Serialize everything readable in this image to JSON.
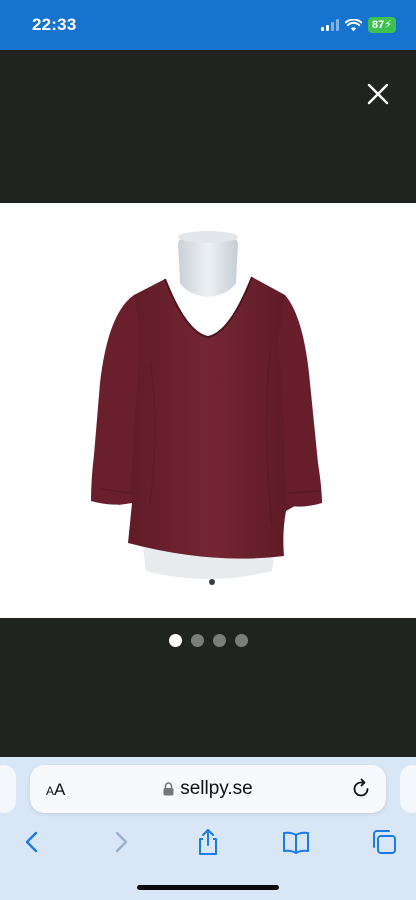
{
  "status_bar": {
    "time": "22:33",
    "battery": "87",
    "icons": [
      "cellular-signal-icon",
      "wifi-icon",
      "battery-charging-icon"
    ]
  },
  "viewer": {
    "close_icon": "close-icon",
    "image_count": 4,
    "active_image": 1,
    "garment_color": "#6b1f2b"
  },
  "browser": {
    "text_size_label": "AA",
    "url": "sellpy.se",
    "icons": [
      "lock-icon",
      "reload-icon",
      "back-icon",
      "forward-icon",
      "share-icon",
      "bookmarks-icon",
      "tabs-icon"
    ]
  },
  "colors": {
    "status_bar": "#1673cf",
    "viewer_bg": "#1f2420",
    "browser_bg": "#d9e6f6",
    "accent": "#1a7ae8"
  }
}
